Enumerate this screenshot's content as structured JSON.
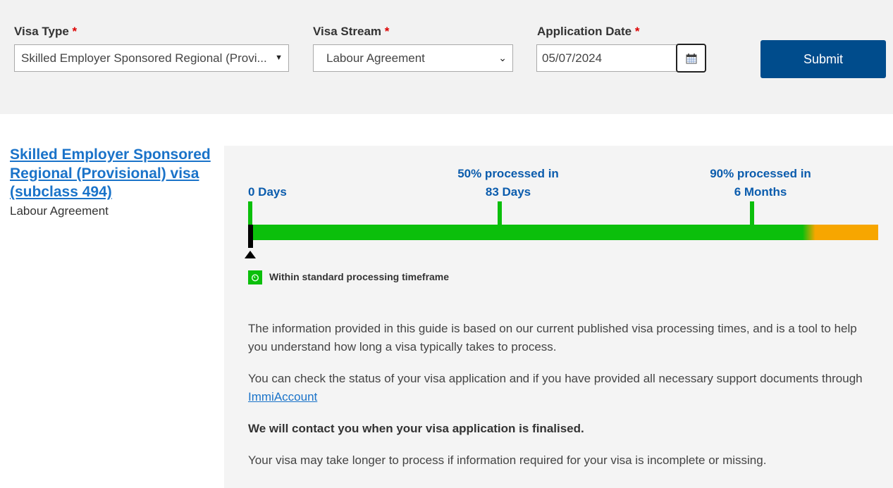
{
  "form": {
    "visa_type": {
      "label": "Visa Type",
      "required": "*",
      "value": "Skilled Employer Sponsored Regional (Provi..."
    },
    "visa_stream": {
      "label": "Visa Stream",
      "required": "*",
      "value": "Labour Agreement"
    },
    "application_date": {
      "label": "Application Date",
      "required": "*",
      "value": "05/07/2024"
    },
    "submit_label": "Submit"
  },
  "result": {
    "title": "Skilled Employer Sponsored Regional (Provisional) visa (subclass 494)",
    "stream": "Labour Agreement"
  },
  "timeline": {
    "start": {
      "line1": "0 Days"
    },
    "p50": {
      "line1": "50% processed in",
      "line2": "83 Days"
    },
    "p90": {
      "line1": "90% processed in",
      "line2": "6 Months"
    },
    "status": "Within standard processing timeframe",
    "colors": {
      "within": "#0bbf0b",
      "beyond": "#f7a600",
      "label": "#0b5cad"
    }
  },
  "info": {
    "p1": "The information provided in this guide is based on our current published visa processing times, and is a tool to help you understand how long a visa typically takes to process.",
    "p2_text": "You can check the status of your visa application and if you have provided all necessary support documents through ",
    "p2_link": "ImmiAccount",
    "p3": "We will contact you when your visa application is finalised.",
    "p4": "Your visa may take longer to process if information required for your visa is incomplete or missing."
  }
}
